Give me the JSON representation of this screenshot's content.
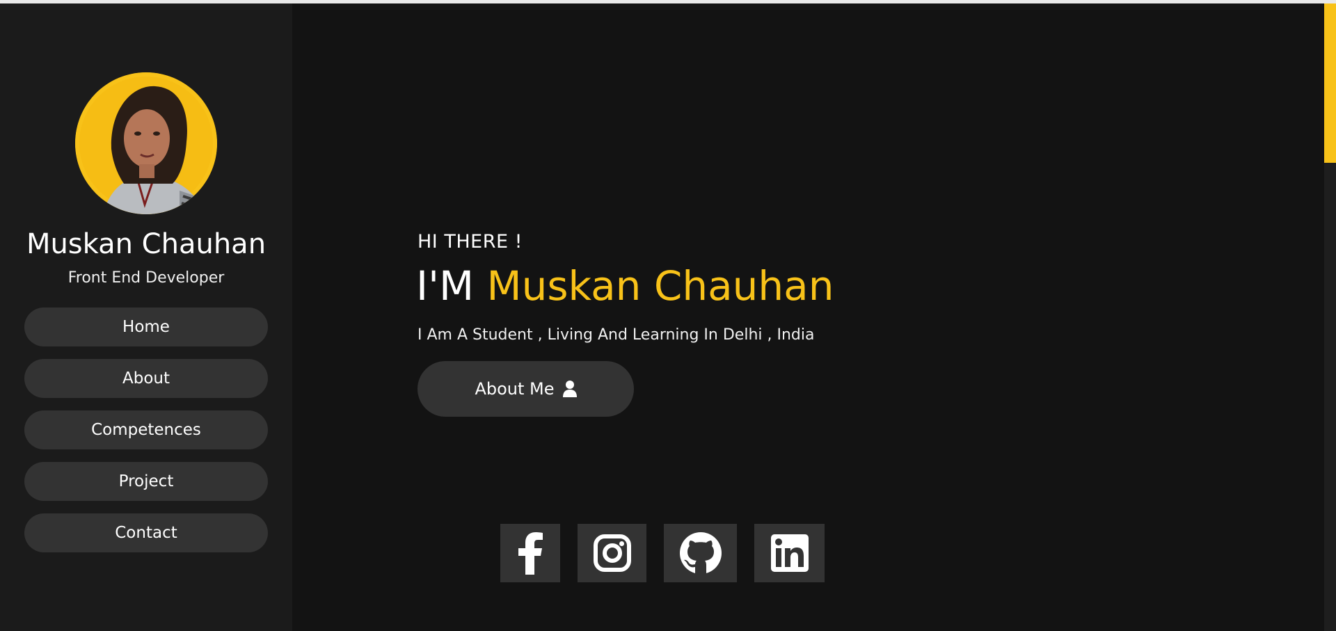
{
  "sidebar": {
    "name": "Muskan Chauhan",
    "role": "Front End Developer",
    "nav": [
      {
        "label": "Home"
      },
      {
        "label": "About"
      },
      {
        "label": "Competences"
      },
      {
        "label": "Project"
      },
      {
        "label": "Contact"
      }
    ]
  },
  "hero": {
    "greeting": "HI THERE !",
    "title_prefix": "I'M",
    "title_name": "Muskan Chauhan",
    "description": "I Am A Student , Living And Learning In Delhi , India",
    "button_label": "About Me",
    "button_icon": "user-icon"
  },
  "social": [
    {
      "icon": "facebook-icon"
    },
    {
      "icon": "instagram-icon"
    },
    {
      "icon": "github-icon"
    },
    {
      "icon": "linkedin-icon"
    }
  ],
  "colors": {
    "accent": "#f8c219",
    "background": "#131313",
    "sidebar": "#1b1b1b",
    "button": "#333333"
  }
}
